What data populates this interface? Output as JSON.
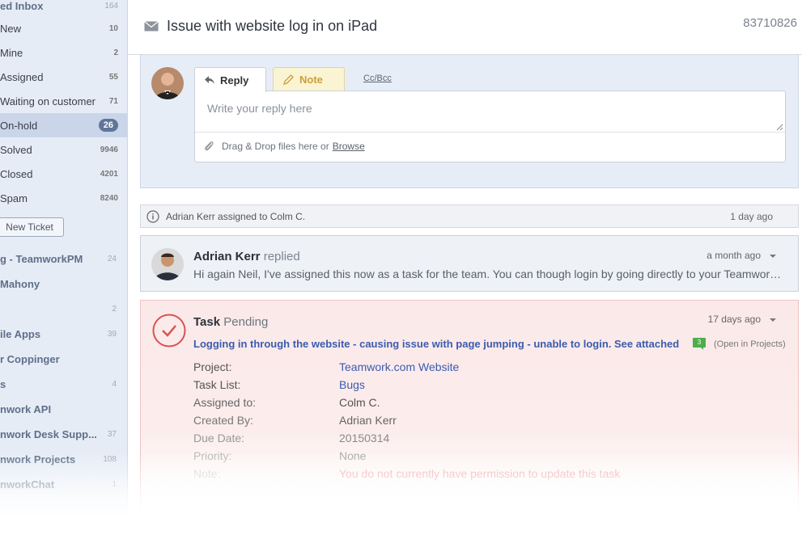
{
  "sidebar": {
    "inbox_label": "ed Inbox",
    "inbox_count": "164",
    "items": [
      {
        "label": "New",
        "count": "10"
      },
      {
        "label": "Mine",
        "count": "2"
      },
      {
        "label": "Assigned",
        "count": "55"
      },
      {
        "label": "Waiting on customer",
        "count": "71"
      },
      {
        "label": "On-hold",
        "count": "26",
        "active": true
      },
      {
        "label": "Solved",
        "count": "9946"
      },
      {
        "label": "Closed",
        "count": "4201"
      },
      {
        "label": "Spam",
        "count": "8240"
      }
    ],
    "new_ticket_label": "New Ticket",
    "sections": [
      {
        "label": "g - TeamworkPM",
        "count": "24"
      },
      {
        "label": "Mahony",
        "count": ""
      },
      {
        "label": "",
        "count": "2"
      },
      {
        "label": "ile Apps",
        "count": "39"
      },
      {
        "label": "r Coppinger",
        "count": ""
      },
      {
        "label": "s",
        "count": "4"
      },
      {
        "label": "nwork API",
        "count": ""
      },
      {
        "label": "nwork Desk Supp...",
        "count": "37"
      },
      {
        "label": "nwork Projects",
        "count": "108"
      },
      {
        "label": "nworkChat",
        "count": "1"
      }
    ]
  },
  "header": {
    "title": "Issue with website log in on iPad",
    "ticket_id": "83710826"
  },
  "reply": {
    "tab_reply": "Reply",
    "tab_note": "Note",
    "ccbcc": "Cc/Bcc",
    "placeholder": "Write your reply here",
    "drop_text": "Drag & Drop files here or",
    "browse": "Browse"
  },
  "event": {
    "text": "Adrian Kerr assigned to Colm C.",
    "time": "1 day ago"
  },
  "message": {
    "author": "Adrian Kerr",
    "verb": "replied",
    "time": "a month ago",
    "preview": "Hi again Neil, I've assigned this now as a task for the team. You can though login by going directly to your Teamwork.com site..."
  },
  "task": {
    "label": "Task",
    "status": "Pending",
    "time": "17 days ago",
    "title": "Logging in through the website - causing issue with page jumping - unable to login. See attached",
    "comment_count": "3",
    "open_in_projects": "(Open in Projects)",
    "fields": [
      {
        "key": "Project:",
        "value": "Teamwork.com Website",
        "link": true
      },
      {
        "key": "Task List:",
        "value": "Bugs",
        "link": true
      },
      {
        "key": "Assigned to:",
        "value": "Colm C."
      },
      {
        "key": "Created By:",
        "value": "Adrian Kerr"
      },
      {
        "key": "Due Date:",
        "value": "20150314"
      },
      {
        "key": "Priority:",
        "value": "None"
      },
      {
        "key": "Note:",
        "value": "You do not currently have permission to update this task",
        "warn": true
      }
    ]
  },
  "colors": {
    "accent_link": "#3b5cad",
    "sidebar_bg": "#e6ecf6",
    "task_bg": "#fbe9e9",
    "task_check": "#d9534f",
    "note_bg": "#fbf4d2",
    "badge_green": "#4cae4c"
  }
}
